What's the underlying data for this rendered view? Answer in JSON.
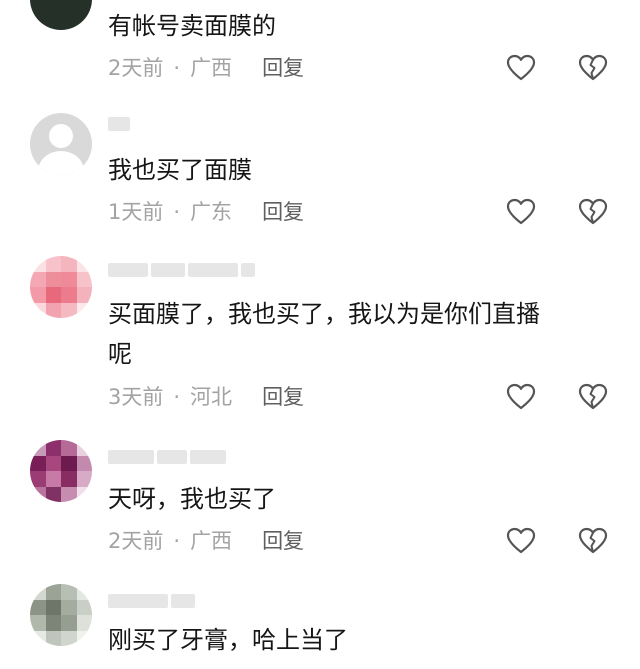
{
  "comments": [
    {
      "text": "有帐号卖面膜的",
      "time": "2天前",
      "location": "广西",
      "reply_label": "回复",
      "like_icon": "heart-outline-icon",
      "dislike_icon": "broken-heart-outline-icon"
    },
    {
      "text": "我也买了面膜",
      "time": "1天前",
      "location": "广东",
      "reply_label": "回复",
      "like_icon": "heart-outline-icon",
      "dislike_icon": "broken-heart-outline-icon"
    },
    {
      "text": "买面膜了，我也买了，我以为是你们直播\n呢",
      "time": "3天前",
      "location": "河北",
      "reply_label": "回复",
      "like_icon": "heart-outline-icon",
      "dislike_icon": "broken-heart-outline-icon"
    },
    {
      "text": "天呀，我也买了",
      "time": "2天前",
      "location": "广西",
      "reply_label": "回复",
      "like_icon": "heart-outline-icon",
      "dislike_icon": "broken-heart-outline-icon"
    },
    {
      "text": "刚买了牙膏，哈上当了"
    }
  ],
  "separator": "·",
  "colors": {
    "text": "#161616",
    "meta": "#a3a3a3",
    "reply": "#5f5f5f",
    "icon_stroke": "#555555"
  }
}
